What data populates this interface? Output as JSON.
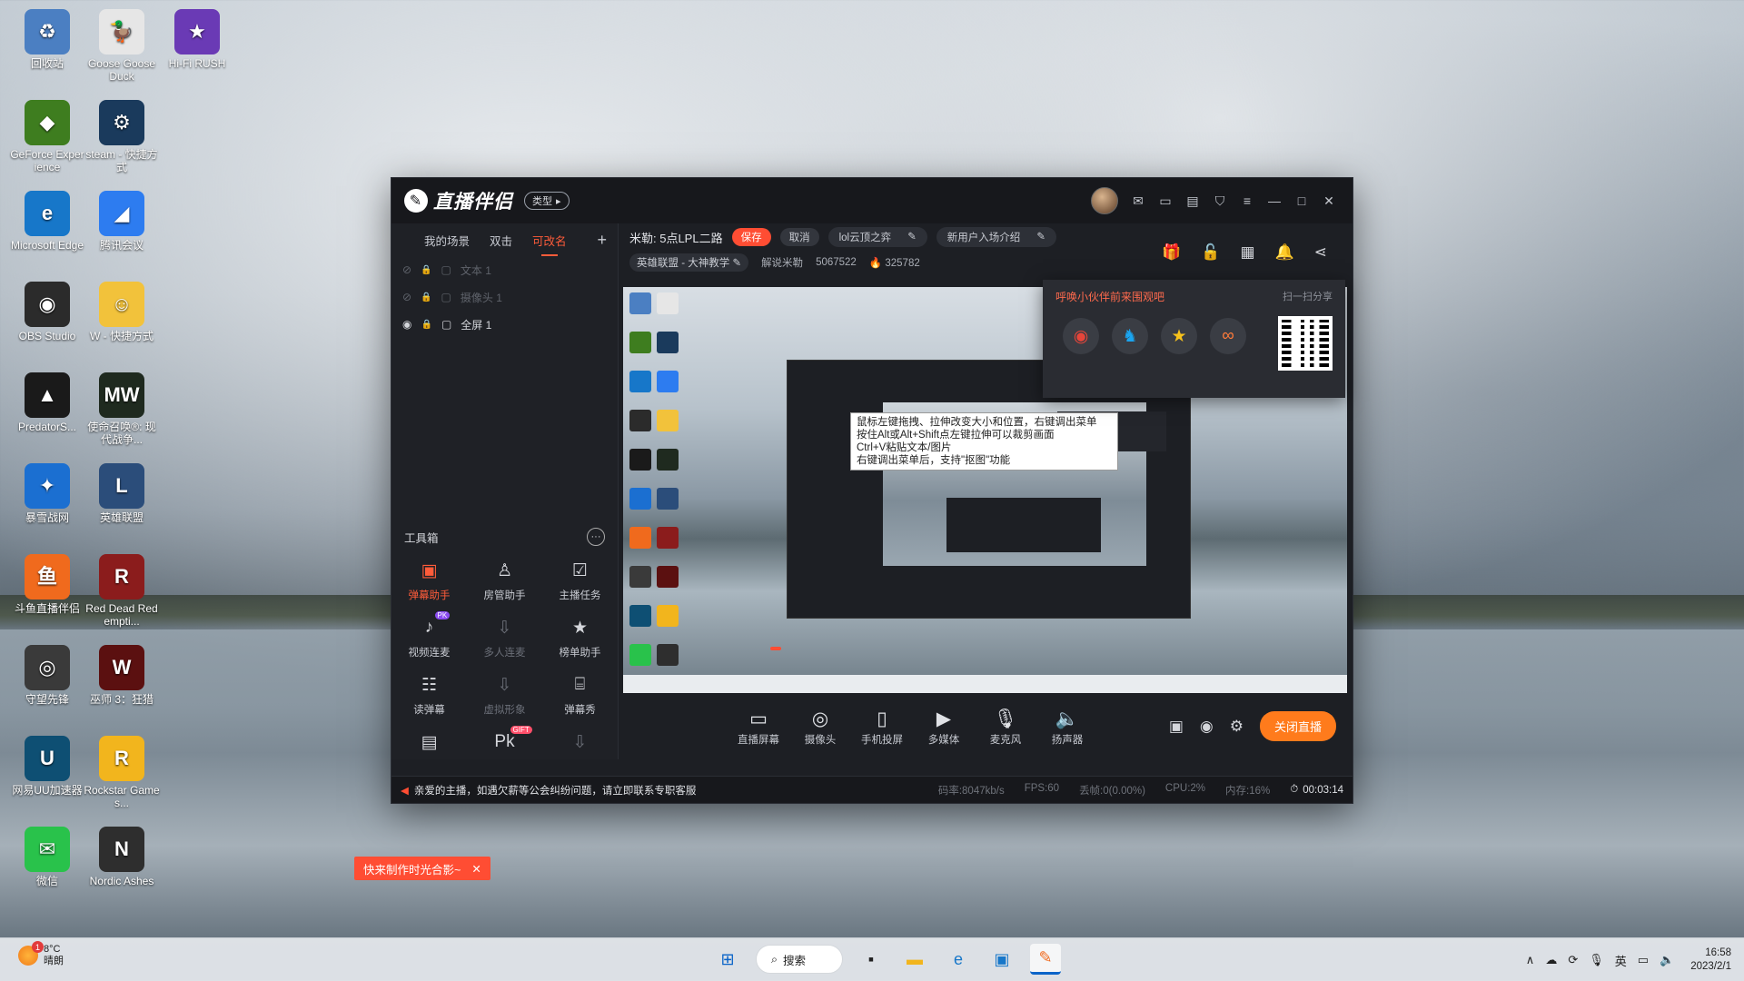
{
  "desktop": {
    "icons": [
      {
        "label": "回收站",
        "color": "#4b7fc2",
        "glyph": "♻"
      },
      {
        "label": "Goose Goose Duck",
        "color": "#e6e6e6",
        "glyph": "🦆"
      },
      {
        "label": "Hi-Fi RUSH",
        "color": "#6a3ab5",
        "glyph": "★"
      },
      {
        "label": "GeForce Experience",
        "color": "#3e7d1f",
        "glyph": "◆"
      },
      {
        "label": "steam - 快捷方式",
        "color": "#1a3a5c",
        "glyph": "⚙"
      },
      {
        "label": "Microsoft Edge",
        "color": "#1777c9",
        "glyph": "e"
      },
      {
        "label": "腾讯会议",
        "color": "#2d7cf0",
        "glyph": "◢"
      },
      {
        "label": "OBS Studio",
        "color": "#2b2b2b",
        "glyph": "◉"
      },
      {
        "label": "W - 快捷方式",
        "color": "#f2c23b",
        "glyph": "☺"
      },
      {
        "label": "PredatorS...",
        "color": "#1a1a1a",
        "glyph": "▲"
      },
      {
        "label": "使命召唤®: 现代战争...",
        "color": "#1f2a1f",
        "glyph": "MW"
      },
      {
        "label": "暴雪战网",
        "color": "#1b6fd1",
        "glyph": "✦"
      },
      {
        "label": "英雄联盟",
        "color": "#2b4d7a",
        "glyph": "L"
      },
      {
        "label": "斗鱼直播伴侣",
        "color": "#f06a1d",
        "glyph": "鱼"
      },
      {
        "label": "Red Dead Redempti...",
        "color": "#8b1c1c",
        "glyph": "R"
      },
      {
        "label": "守望先锋",
        "color": "#3a3a3a",
        "glyph": "◎"
      },
      {
        "label": "巫师 3：狂猎",
        "color": "#5b1010",
        "glyph": "W"
      },
      {
        "label": "网易UU加速器",
        "color": "#0e4f73",
        "glyph": "U"
      },
      {
        "label": "Rockstar Games...",
        "color": "#f2b51d",
        "glyph": "R"
      },
      {
        "label": "微信",
        "color": "#29c24b",
        "glyph": "✉"
      },
      {
        "label": "Nordic Ashes",
        "color": "#2e2e2e",
        "glyph": "N"
      }
    ]
  },
  "app": {
    "logo_text": "直播伴侣",
    "type_button": "类型",
    "scene_tabs": [
      "我的场景",
      "双击",
      "可改名"
    ],
    "active_tab": 2,
    "sources": [
      {
        "label": "文本 1",
        "visible": false
      },
      {
        "label": "摄像头 1",
        "visible": false
      },
      {
        "label": "全屏 1",
        "visible": true
      }
    ],
    "toolbox_title": "工具箱",
    "tools": [
      {
        "label": "弹幕助手",
        "icon": "danmaku-icon",
        "glyph": "▣",
        "state": "active"
      },
      {
        "label": "房管助手",
        "icon": "admin-icon",
        "glyph": "♙",
        "state": "normal"
      },
      {
        "label": "主播任务",
        "icon": "task-icon",
        "glyph": "☑",
        "state": "normal"
      },
      {
        "label": "视频连麦",
        "icon": "video-link-icon",
        "glyph": "♪",
        "state": "normal",
        "tag": "PK"
      },
      {
        "label": "多人连麦",
        "icon": "download-icon",
        "glyph": "⇩",
        "state": "dim"
      },
      {
        "label": "榜单助手",
        "icon": "rank-icon",
        "glyph": "★",
        "state": "normal"
      },
      {
        "label": "读弹幕",
        "icon": "read-danmaku-icon",
        "glyph": "☷",
        "state": "normal"
      },
      {
        "label": "虚拟形象",
        "icon": "download-icon",
        "glyph": "⇩",
        "state": "dim"
      },
      {
        "label": "弹幕秀",
        "icon": "danmaku-show-icon",
        "glyph": "⌸",
        "state": "normal"
      },
      {
        "label": "",
        "icon": "tool-icon",
        "glyph": "▤",
        "state": "normal"
      },
      {
        "label": "",
        "icon": "pk-icon",
        "glyph": "Pk",
        "state": "normal",
        "tag": "GIFT"
      },
      {
        "label": "",
        "icon": "download-icon",
        "glyph": "⇩",
        "state": "dim"
      }
    ],
    "header": {
      "title": "米勒: 5点LPL二路",
      "save": "保存",
      "cancel": "取消",
      "field1": "lol云顶之弈",
      "field2": "新用户入场介绍",
      "game": "英雄联盟 - 大神教学",
      "account": "解说米勒",
      "room_id": "5067522",
      "heat": "325782"
    },
    "share": {
      "title": "呼唤小伙伴前来围观吧",
      "scan": "扫一扫分享"
    },
    "preview": {
      "tooltip_lines": [
        "鼠标左键拖拽、拉伸改变大小和位置，右键调出菜单",
        "按住Alt或Alt+Shift点左键拉伸可以裁剪画面",
        "Ctrl+V粘贴文本/图片",
        "右键调出菜单后，支持\"抠图\"功能"
      ]
    },
    "controls": [
      {
        "label": "直播屏幕",
        "glyph": "▭",
        "icon": "screen-icon"
      },
      {
        "label": "摄像头",
        "glyph": "◎",
        "icon": "camera-icon"
      },
      {
        "label": "手机投屏",
        "glyph": "▯",
        "icon": "phone-cast-icon"
      },
      {
        "label": "多媒体",
        "glyph": "▶",
        "icon": "media-icon"
      },
      {
        "label": "麦克风",
        "glyph": "🎙",
        "icon": "microphone-icon"
      },
      {
        "label": "扬声器",
        "glyph": "🔈",
        "icon": "speaker-icon"
      }
    ],
    "live_button": "关闭直播",
    "status": {
      "notice": "亲爱的主播，如遇欠薪等公会纠纷问题，请立即联系专职客服",
      "bitrate": "码率:8047kb/s",
      "fps": "FPS:60",
      "drop": "丢帧:0(0.00%)",
      "cpu": "CPU:2%",
      "memory": "内存:16%",
      "timer": "00:03:14"
    }
  },
  "toast": {
    "text": "快来制作时光合影~"
  },
  "taskbar": {
    "weather_badge": "1",
    "temp": "8°C",
    "weather": "晴朗",
    "search": "搜索",
    "ime": "英",
    "time": "16:58",
    "date": "2023/2/1"
  },
  "colors": {
    "accent": "#ff4d33",
    "live": "#ff7b1c"
  }
}
